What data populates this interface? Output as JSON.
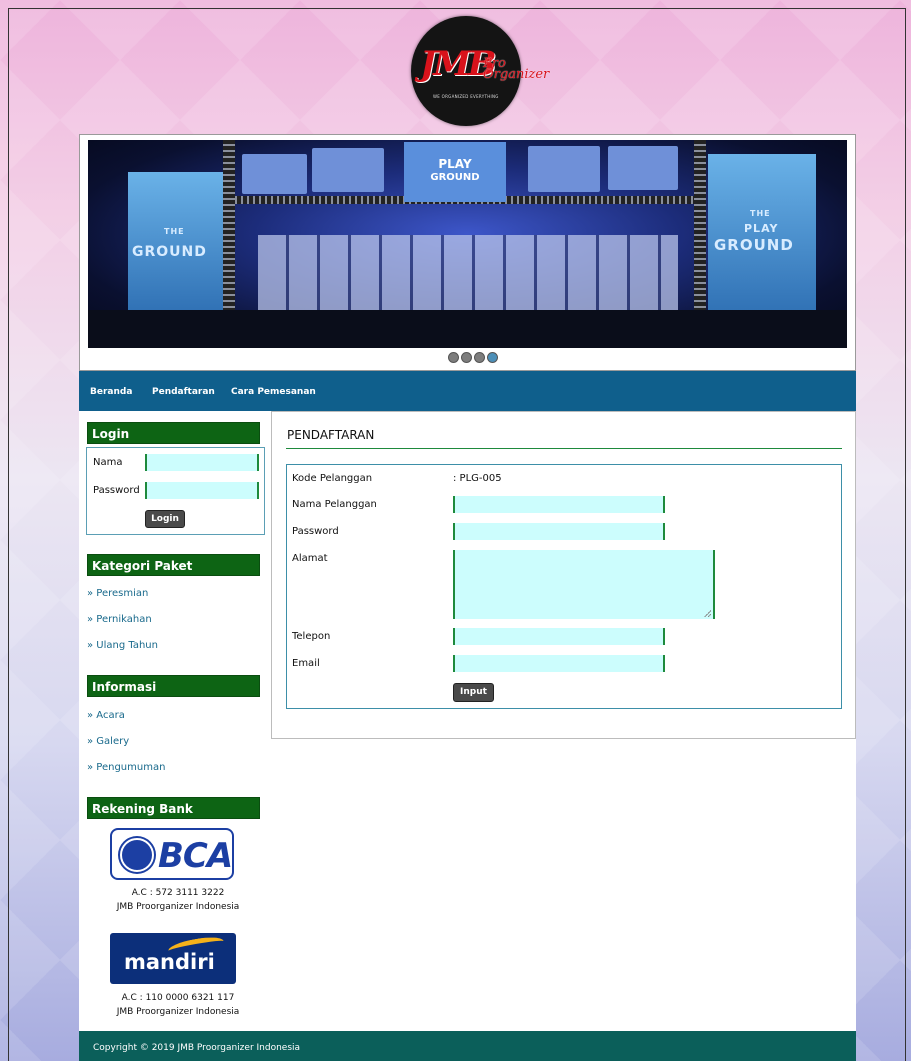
{
  "logo": {
    "brand": "JMB",
    "subtitle_1": "Pro",
    "subtitle_2": "Organizer",
    "tagline": "WE ORGANIZED EVERYTHING"
  },
  "banner": {
    "sign_line_1": "PLAY",
    "sign_line_2": "GROUND",
    "left_banner_1": "THE",
    "left_banner_2": "GROUND",
    "right_banner_1": "THE",
    "right_banner_2": "PLAY",
    "right_banner_3": "GROUND",
    "active_slide": 4,
    "slide_count": 4
  },
  "nav": {
    "items": [
      {
        "label": "Beranda"
      },
      {
        "label": "Pendaftaran"
      },
      {
        "label": "Cara Pemesanan"
      }
    ]
  },
  "sidebar": {
    "login": {
      "title": "Login",
      "nama_label": "Nama",
      "password_label": "Password",
      "button": "Login"
    },
    "kategori": {
      "title": "Kategori Paket",
      "items": [
        "» Peresmian",
        "» Pernikahan",
        "» Ulang Tahun"
      ]
    },
    "informasi": {
      "title": "Informasi",
      "items": [
        "» Acara",
        "» Galery",
        "» Pengumuman"
      ]
    },
    "rekening": {
      "title": "Rekening Bank",
      "banks": [
        {
          "logo_text": "BCA",
          "account": "A.C : 572 3111 3222",
          "holder": "JMB Proorganizer Indonesia"
        },
        {
          "logo_text": "mandiri",
          "account": "A.C : 110 0000 6321 117",
          "holder": "JMB Proorganizer Indonesia"
        }
      ]
    }
  },
  "content": {
    "title": "PENDAFTARAN",
    "form": {
      "kode_label": "Kode Pelanggan",
      "kode_value": ": PLG-005",
      "nama_label": "Nama Pelanggan",
      "password_label": "Password",
      "alamat_label": "Alamat",
      "telepon_label": "Telepon",
      "email_label": "Email",
      "submit": "Input"
    }
  },
  "footer": {
    "text": "Copyright © 2019 JMB Proorganizer Indonesia"
  },
  "colors": {
    "nav": "#0f5f8c",
    "side_header": "#0d6414",
    "footer": "#0b5f5a",
    "input_bg": "#ccfdfd",
    "accent_green": "#1e8a3c"
  }
}
